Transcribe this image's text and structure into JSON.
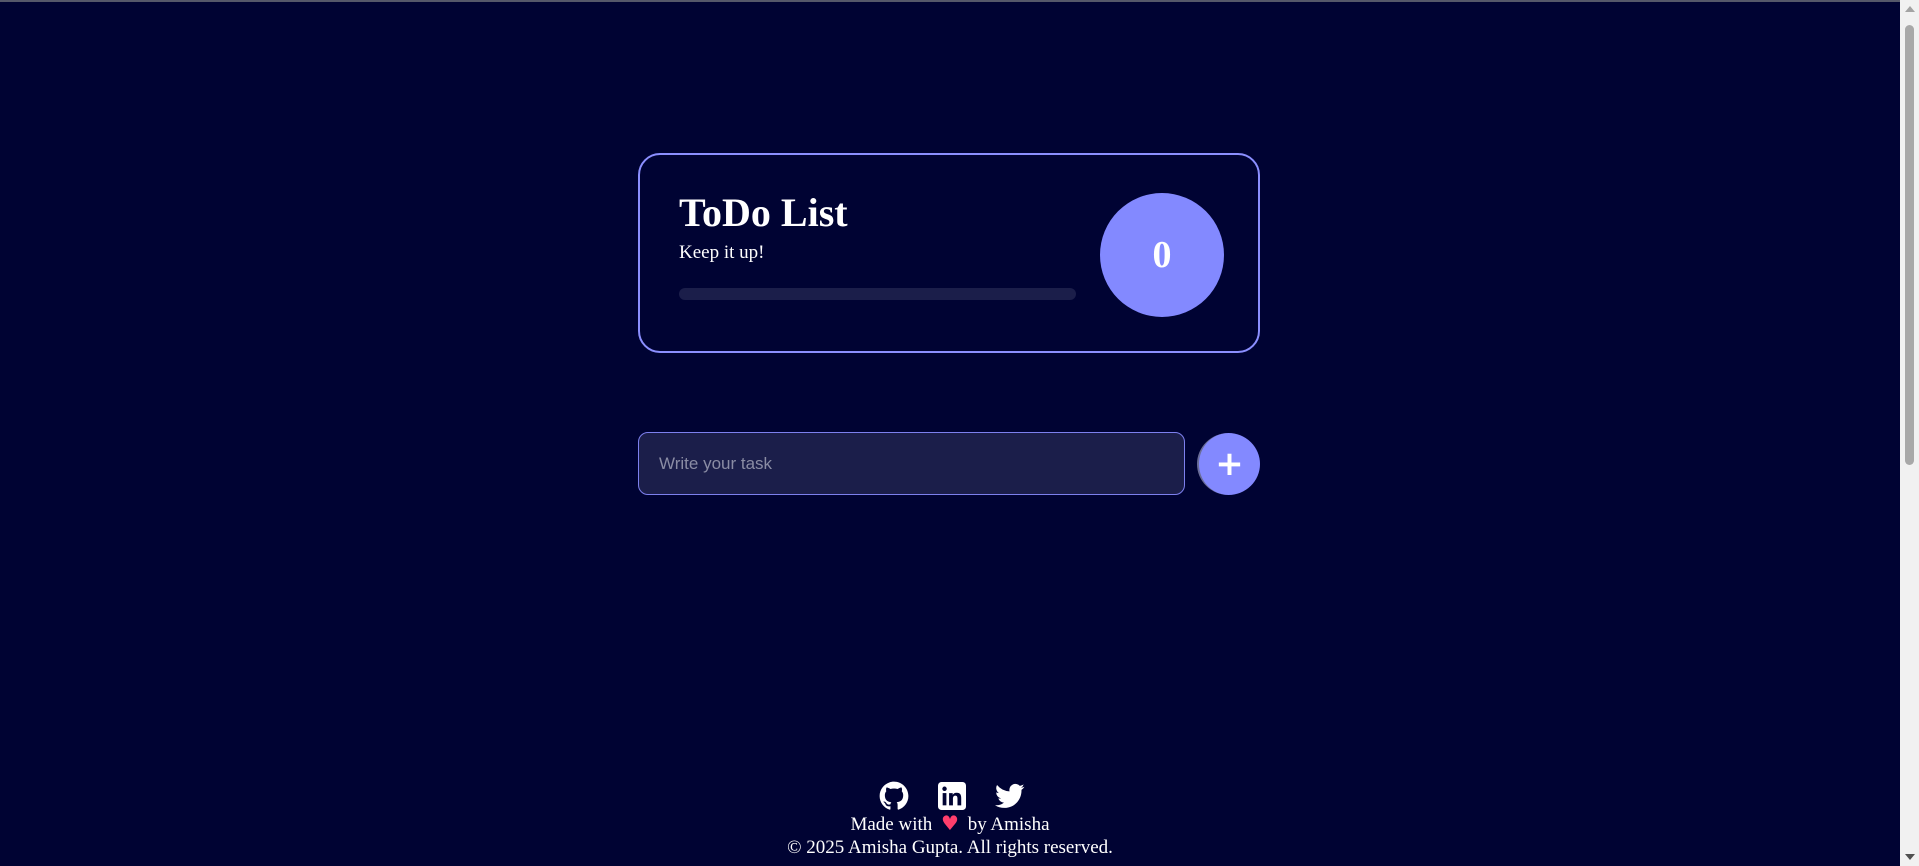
{
  "app": {
    "title": "ToDo List",
    "subtitle": "Keep it up!",
    "task_count": "0",
    "progress": 0
  },
  "form": {
    "placeholder": "Write your task",
    "value": "",
    "add_button_label": "+"
  },
  "footer": {
    "social_links": [
      {
        "name": "github-icon"
      },
      {
        "name": "linkedin-icon"
      },
      {
        "name": "twitter-icon"
      }
    ],
    "made_with_prefix": "Made with",
    "heart": "♥",
    "made_with_suffix": "by Amisha",
    "copyright": "© 2025 Amisha Gupta. All rights reserved."
  },
  "colors": {
    "background": "#000333",
    "accent": "#8389ff",
    "input_bg": "#1b1e4a",
    "heart": "#ff3e6c"
  }
}
